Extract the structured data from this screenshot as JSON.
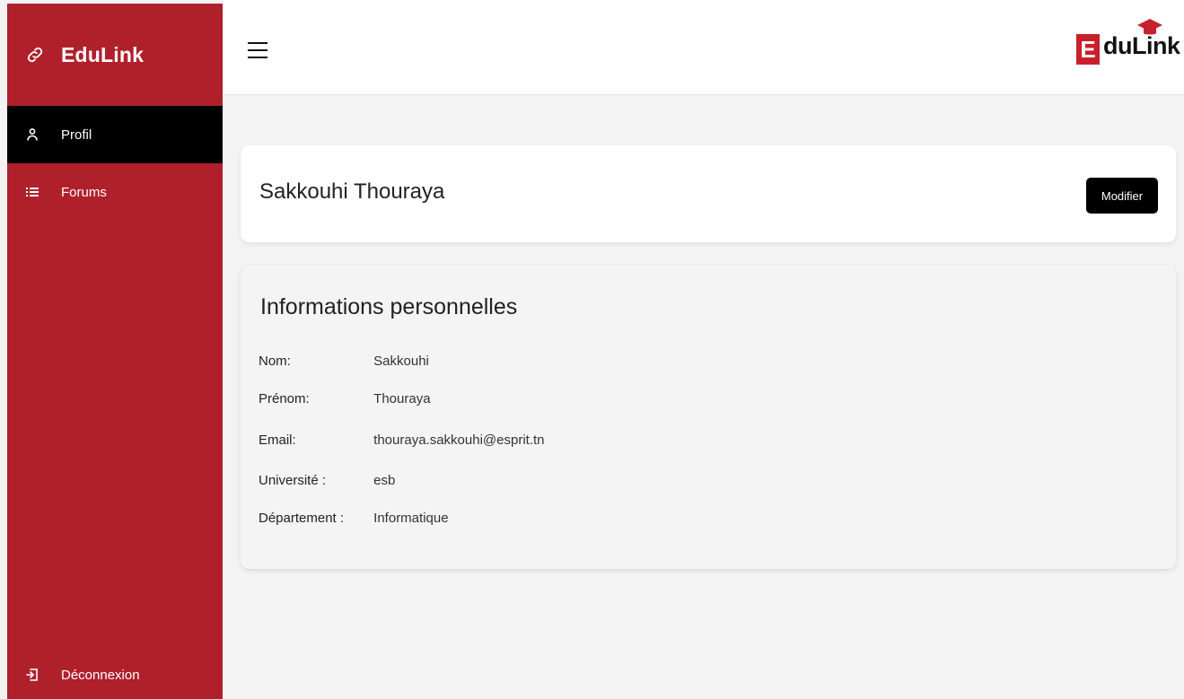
{
  "sidebar": {
    "brand": "EduLink",
    "items": [
      {
        "label": "Profil",
        "icon": "user-icon",
        "active": true
      },
      {
        "label": "Forums",
        "icon": "list-icon",
        "active": false
      }
    ],
    "logout_label": "Déconnexion"
  },
  "topbar": {
    "logo_letter": "E",
    "logo_text": "duLink"
  },
  "profile": {
    "full_name": "Sakkouhi Thouraya",
    "edit_label": "Modifier"
  },
  "info": {
    "title": "Informations personnelles",
    "rows": [
      {
        "label": "Nom:",
        "value": "Sakkouhi"
      },
      {
        "label": "Prénom:",
        "value": "Thouraya"
      },
      {
        "label": "Email:",
        "value": "thouraya.sakkouhi@esprit.tn"
      },
      {
        "label": "Université :",
        "value": "esb"
      },
      {
        "label": "Département :",
        "value": "Informatique"
      }
    ]
  },
  "colors": {
    "sidebar_bg": "#b0202b",
    "active_bg": "#000000",
    "page_bg": "#f3f3f3"
  }
}
